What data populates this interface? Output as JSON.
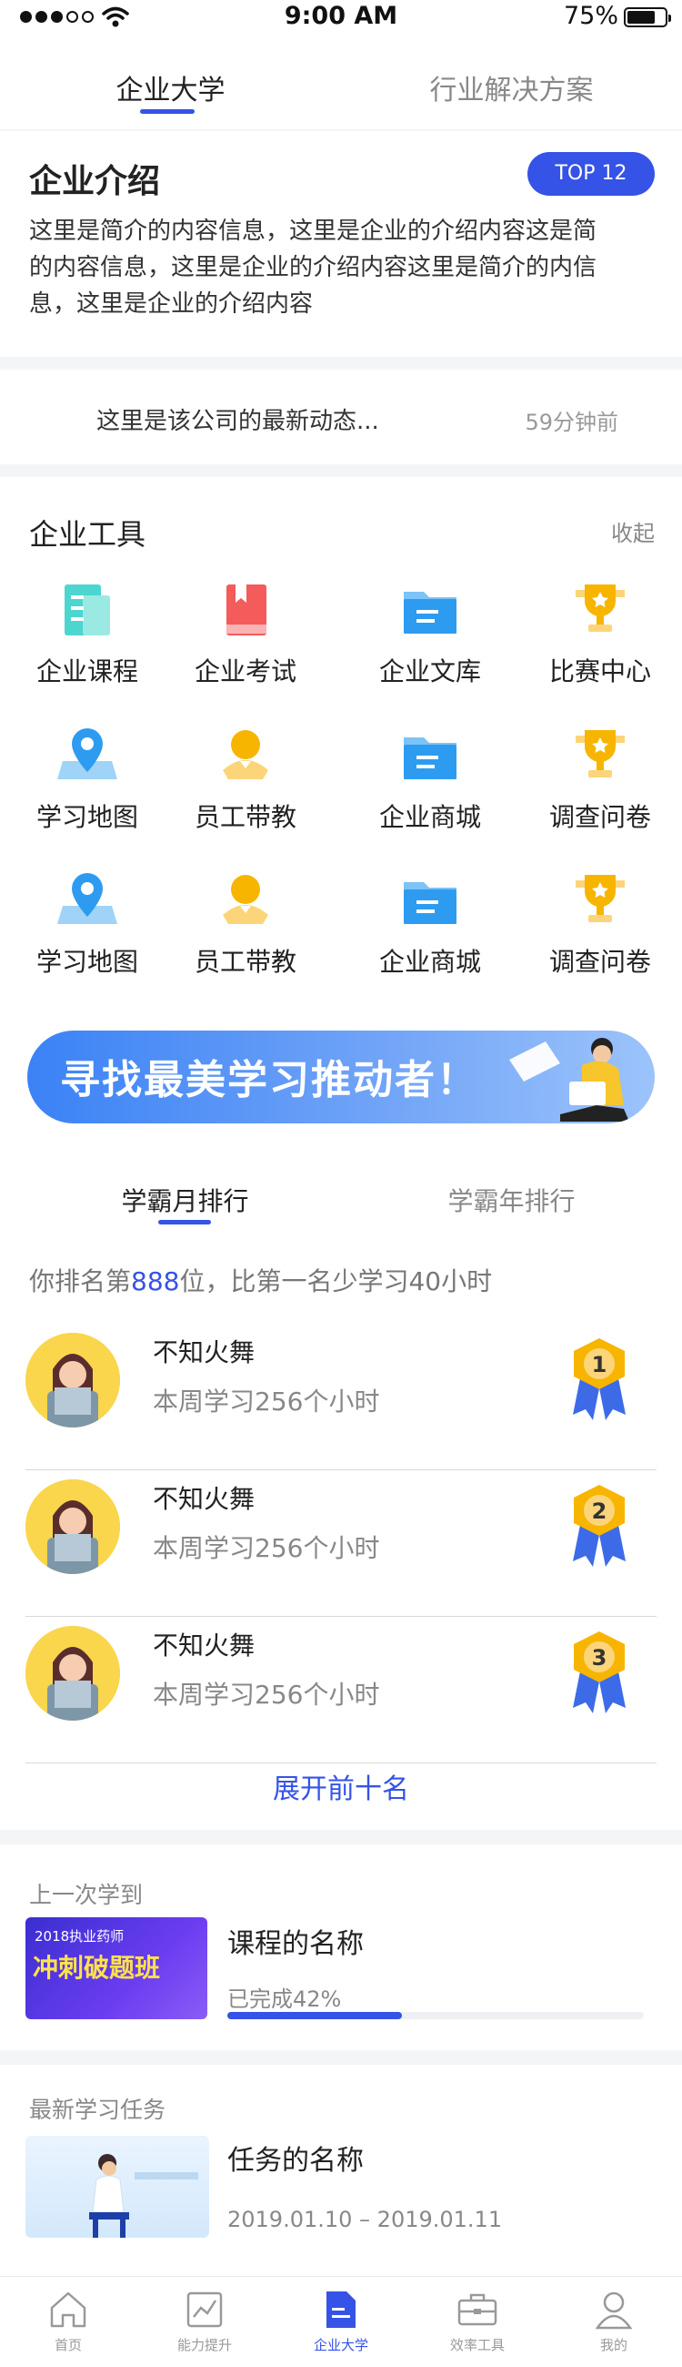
{
  "status": {
    "time": "9:00 AM",
    "battery": "75%"
  },
  "topnav": {
    "tabs": [
      "企业大学",
      "行业解决方案"
    ]
  },
  "intro": {
    "title": "企业介绍",
    "badge": "TOP 12",
    "lines": [
      "这里是简介的内容信息，这里是企业的介绍内容这是简",
      "的内容信息，这里是企业的介绍内容这里是简介的内信",
      "息，这里是企业的介绍内容"
    ]
  },
  "news": {
    "text": "这里是该公司的最新动态...",
    "time": "59分钟前"
  },
  "tools": {
    "title": "企业工具",
    "collapse": "收起",
    "items": [
      {
        "label": "企业课程",
        "icon": "course-icon"
      },
      {
        "label": "企业考试",
        "icon": "exam-book-icon"
      },
      {
        "label": "企业文库",
        "icon": "folder-icon"
      },
      {
        "label": "比赛中心",
        "icon": "trophy-icon"
      },
      {
        "label": "学习地图",
        "icon": "map-pin-icon"
      },
      {
        "label": "员工带教",
        "icon": "mentor-icon"
      },
      {
        "label": "企业商城",
        "icon": "folder-icon"
      },
      {
        "label": "调查问卷",
        "icon": "trophy-icon"
      },
      {
        "label": "学习地图",
        "icon": "map-pin-icon"
      },
      {
        "label": "员工带教",
        "icon": "mentor-icon"
      },
      {
        "label": "企业商城",
        "icon": "folder-icon"
      },
      {
        "label": "调查问卷",
        "icon": "trophy-icon"
      }
    ]
  },
  "banner": {
    "text": "寻找最美学习推动者！"
  },
  "rank": {
    "tabs": [
      "学霸月排行",
      "学霸年排行"
    ],
    "summary_pre": "你排名第",
    "summary_num": "888",
    "summary_post": "位，比第一名少学习40小时",
    "rows": [
      {
        "name": "不知火舞",
        "desc": "本周学习256个小时",
        "medal": "1"
      },
      {
        "name": "不知火舞",
        "desc": "本周学习256个小时",
        "medal": "2"
      },
      {
        "name": "不知火舞",
        "desc": "本周学习256个小时",
        "medal": "3"
      }
    ],
    "expand": "展开前十名"
  },
  "last": {
    "label": "上一次学到",
    "thumb_line1": "2018执业药师",
    "thumb_line2": "冲刺破题班",
    "course_name": "课程的名称",
    "progress_text": "已完成42%",
    "progress": 0.42
  },
  "task": {
    "label": "最新学习任务",
    "name": "任务的名称",
    "date": "2019.01.10 – 2019.01.11"
  },
  "tabbar": {
    "items": [
      {
        "label": "首页",
        "icon": "home-icon"
      },
      {
        "label": "能力提升",
        "icon": "chart-icon"
      },
      {
        "label": "企业大学",
        "icon": "doc-icon"
      },
      {
        "label": "效率工具",
        "icon": "toolbox-icon"
      },
      {
        "label": "我的",
        "icon": "user-icon"
      }
    ],
    "active": 2
  },
  "colors": {
    "accent": "#3553e6",
    "separator": "#f4f5f7"
  }
}
